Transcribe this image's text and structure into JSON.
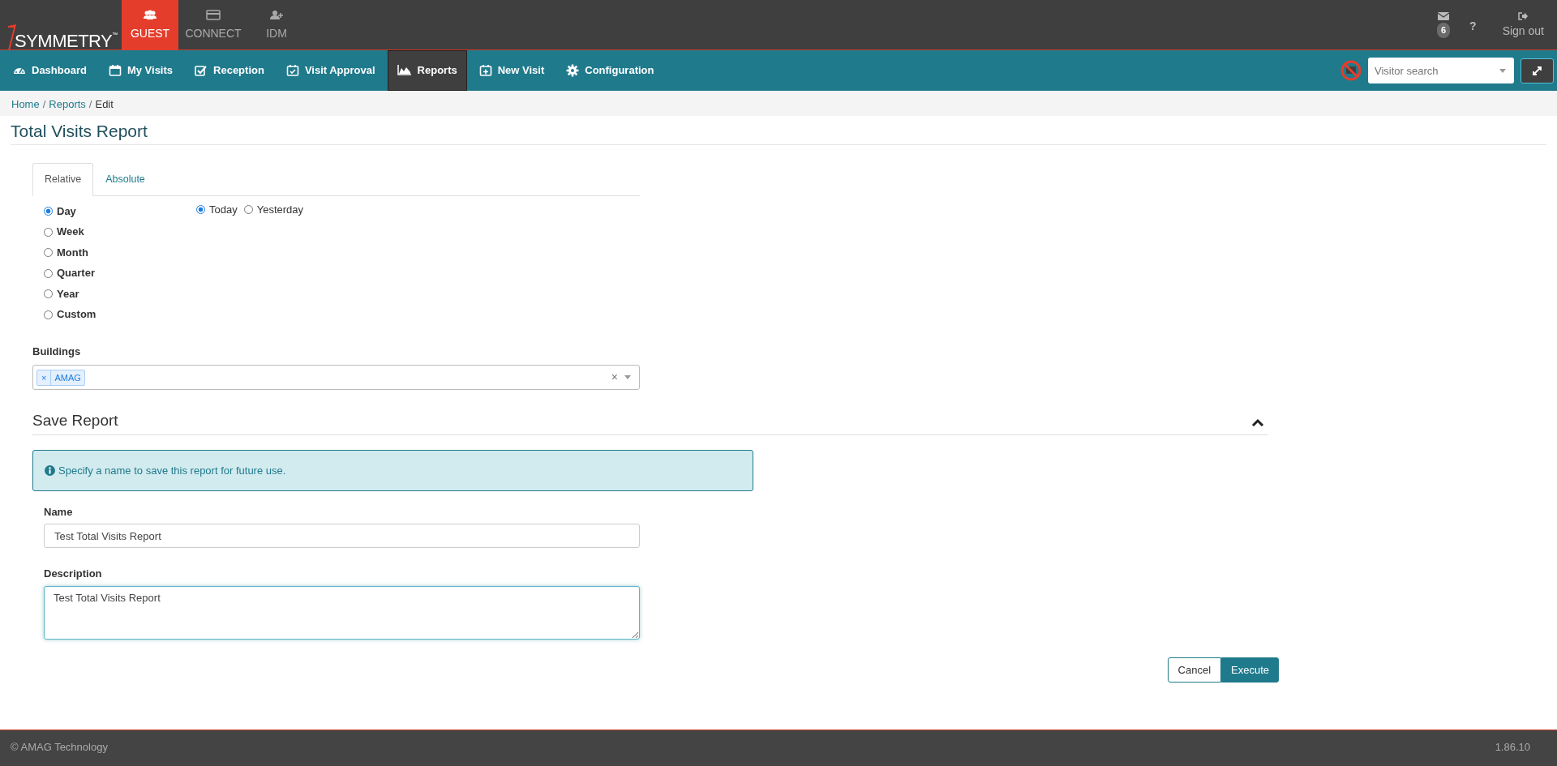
{
  "brand": {
    "name": "SYMMETRY$^{™}$"
  },
  "app_tabs": [
    {
      "label": "GUEST",
      "selected": true
    },
    {
      "label": "CONNECT",
      "selected": false
    },
    {
      "label": "IDM",
      "selected": false
    }
  ],
  "user_menu": {
    "messages_count": "6",
    "help": "?",
    "sign_out": "Sign out"
  },
  "nav": [
    {
      "label": "Dashboard",
      "selected": false
    },
    {
      "label": "My Visits",
      "selected": false
    },
    {
      "label": "Reception",
      "selected": false
    },
    {
      "label": "Visit Approval",
      "selected": false
    },
    {
      "label": "Reports",
      "selected": true
    },
    {
      "label": "New Visit",
      "selected": false
    },
    {
      "label": "Configuration",
      "selected": false
    }
  ],
  "visitor_search": {
    "placeholder": "Visitor search"
  },
  "breadcrumb": {
    "items": [
      "Home",
      "Reports",
      "Edit"
    ],
    "separator": "/"
  },
  "page_title": "Total Visits Report",
  "range_tabs": [
    {
      "label": "Relative",
      "selected": true
    },
    {
      "label": "Absolute",
      "selected": false
    }
  ],
  "periods": [
    {
      "label": "Day",
      "selected": true
    },
    {
      "label": "Week",
      "selected": false
    },
    {
      "label": "Month",
      "selected": false
    },
    {
      "label": "Quarter",
      "selected": false
    },
    {
      "label": "Year",
      "selected": false
    },
    {
      "label": "Custom",
      "selected": false
    }
  ],
  "day_options": [
    {
      "label": "Today",
      "selected": true
    },
    {
      "label": "Yesterday",
      "selected": false
    }
  ],
  "buildings": {
    "label": "Buildings",
    "tags": [
      "AMAG"
    ],
    "remove": "×",
    "clear": "×"
  },
  "save_report": {
    "title": "Save Report",
    "expanded": true,
    "info": "Specify a name to save this report for future use.",
    "name": {
      "label": "Name",
      "value": "Test Total Visits Report"
    },
    "description": {
      "label": "Description",
      "value": "Test Total Visits Report"
    }
  },
  "buttons": [
    {
      "label": "Cancel",
      "kind": "secondary"
    },
    {
      "label": "Execute",
      "kind": "primary"
    }
  ],
  "footer": {
    "copyright": "© AMAG Technology",
    "version": "1.86.10"
  }
}
